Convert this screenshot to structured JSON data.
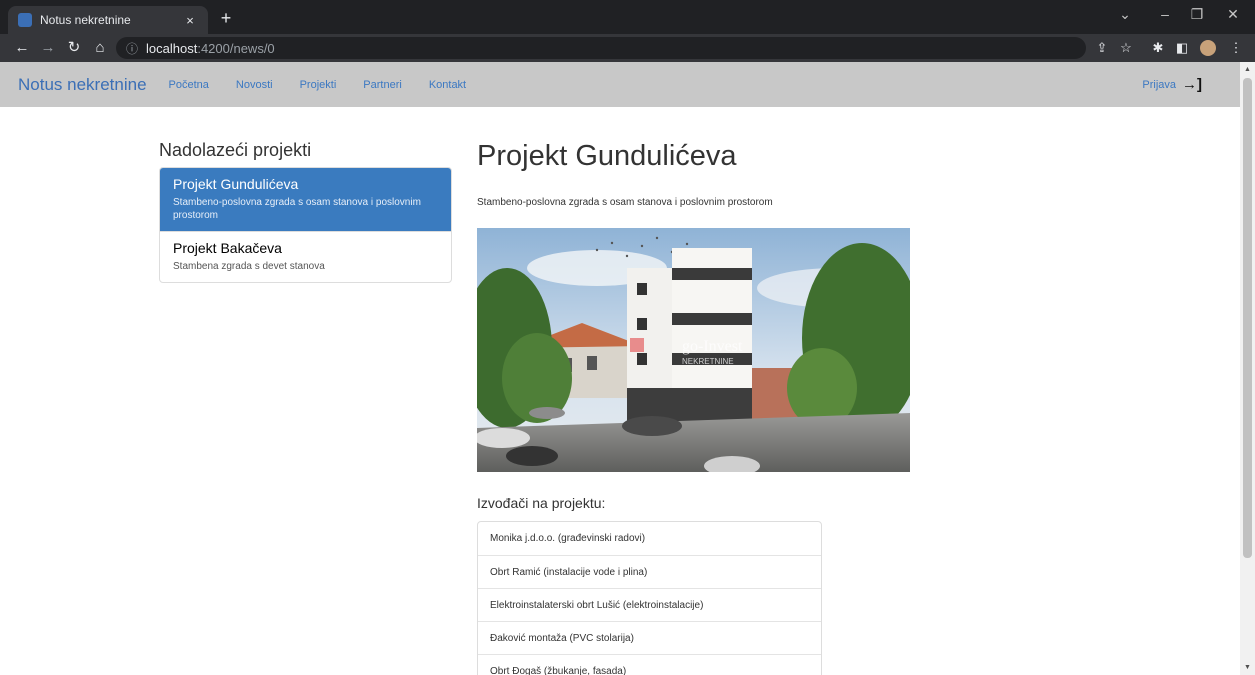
{
  "browser": {
    "tab_title": "Notus nekretnine",
    "tab_close": "×",
    "new_tab": "+",
    "url_host": "localhost",
    "url_path": ":4200/news/0"
  },
  "navbar": {
    "brand": "Notus nekretnine",
    "links": [
      "Početna",
      "Novosti",
      "Projekti",
      "Partneri",
      "Kontakt"
    ],
    "login": "Prijava"
  },
  "sidebar": {
    "heading": "Nadolazeći projekti",
    "items": [
      {
        "title": "Projekt Gundulićeva",
        "desc": "Stambeno-poslovna zgrada s osam stanova i poslovnim prostorom",
        "active": true
      },
      {
        "title": "Projekt Bakačeva",
        "desc": "Stambena zgrada s devet stanova",
        "active": false
      }
    ]
  },
  "project": {
    "title": "Projekt Gundulićeva",
    "subtitle": "Stambeno-poslovna zgrada s osam stanova i poslovnim prostorom",
    "watermark_brand": "go-Invest",
    "watermark_sub": "NEKRETNINE",
    "contractors_heading": "Izvođači na projektu:",
    "contractors": [
      "Monika j.d.o.o. (građevinski radovi)",
      "Obrt Ramić (instalacije vode i plina)",
      "Elektroinstalaterski obrt Lušić (elektroinstalacije)",
      "Đaković montaža (PVC stolarija)",
      "Obrt Đogaš (žbukanje, fasada)"
    ]
  },
  "colors": {
    "accent": "#3a7bbf",
    "navbar_bg": "#c8c8c8",
    "chrome_dark": "#202124"
  }
}
